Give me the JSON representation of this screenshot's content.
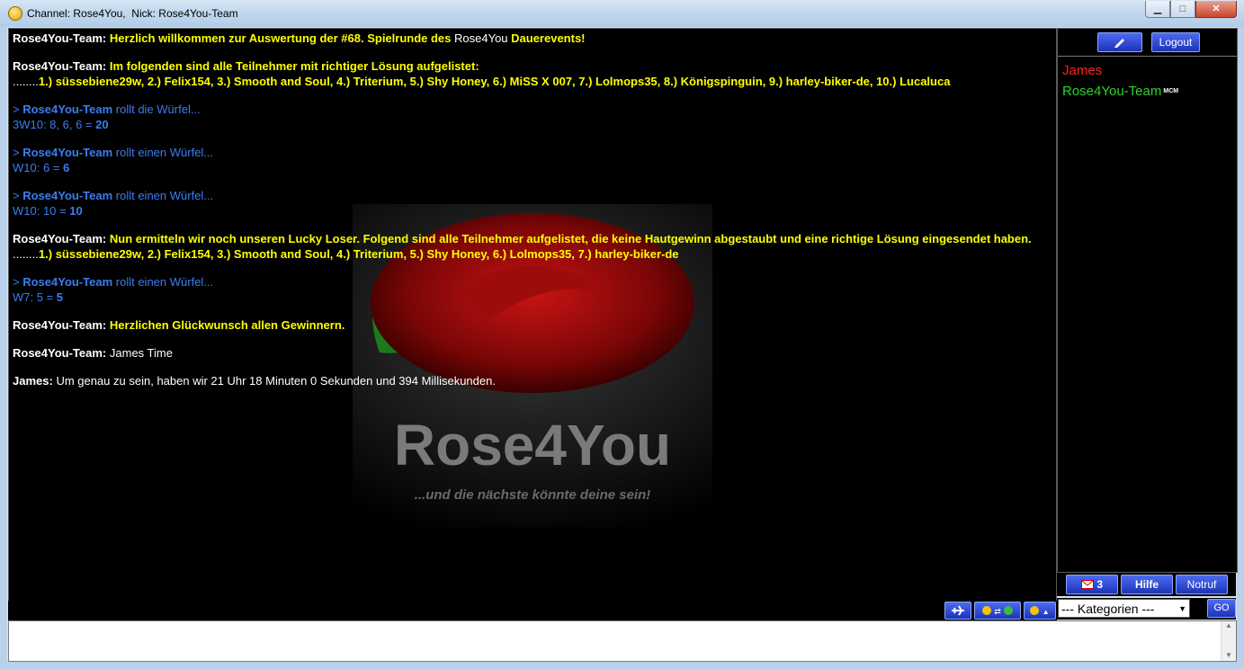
{
  "window": {
    "title": "Channel: Rose4You,  Nick: Rose4You-Team",
    "minimize": "▁",
    "maximize": "□",
    "close": "✕"
  },
  "watermark": {
    "brand": "Rose4You",
    "slogan": "...und die nächste könnte deine sein!"
  },
  "messages": [
    {
      "nick": "Rose4You-Team:",
      "parts": [
        "Herzlich willkommen zur Auswertung der #68. Spielrunde des ",
        "Rose4You",
        " Dauerevents!"
      ]
    },
    {
      "nick": "Rose4You-Team:",
      "text": "Im folgenden sind alle Teilnehmer mit richtiger Lösung aufgelistet:",
      "text2_prefix": "........",
      "text2": "1.) süssebiene29w, 2.) Felix154, 3.) Smooth and Soul, 4.) Triterium, 5.) Shy Honey, 6.) MiSS X 007, 7.) Lolmops35, 8.) Königspinguin, 9.) harley-biker-de, 10.) Lucaluca"
    },
    {
      "prefix": "> ",
      "nick": "Rose4You-Team",
      "action": " rollt die Würfel...",
      "result_label": "3W10: 8, 6, 6 = ",
      "result": "20"
    },
    {
      "prefix": "> ",
      "nick": "Rose4You-Team",
      "action": " rollt einen Würfel...",
      "result_label": "W10: 6 = ",
      "result": "6"
    },
    {
      "prefix": "> ",
      "nick": "Rose4You-Team",
      "action": " rollt einen Würfel...",
      "result_label": "W10: 10 = ",
      "result": "10"
    },
    {
      "nick": "Rose4You-Team:",
      "text": "Nun ermitteln wir noch unseren Lucky Loser. Folgend sind alle Teilnehmer aufgelistet, die keine Hautgewinn abgestaubt und eine richtige Lösung eingesendet haben.",
      "text2_prefix": "........",
      "text2": "1.) süssebiene29w, 2.) Felix154, 3.) Smooth and Soul, 4.) Triterium, 5.) Shy Honey, 6.) Lolmops35, 7.) harley-biker-de"
    },
    {
      "prefix": "> ",
      "nick": "Rose4You-Team",
      "action": " rollt einen Würfel...",
      "result_label": "W7: 5 = ",
      "result": "5"
    },
    {
      "nick": "Rose4You-Team:",
      "text": "Herzlichen Glückwunsch allen Gewinnern."
    },
    {
      "nick": "Rose4You-Team:",
      "text": "James Time"
    },
    {
      "nick": "James:",
      "text": "Um genau zu sein, haben wir 21 Uhr 18 Minuten 0 Sekunden und 394 Millisekunden."
    }
  ],
  "sidebar": {
    "logout": "Logout",
    "users": [
      {
        "name": "James",
        "color": "#ff2020"
      },
      {
        "name": "Rose4You-Team",
        "badge": "MCM",
        "color": "#2fd12f"
      }
    ],
    "mail_count": "3",
    "help": "Hilfe",
    "emergency": "Notruf",
    "category_select": "--- Kategorien ---",
    "go": "GO"
  },
  "colors": {
    "chat_bg": "#000000",
    "system_text": "#ffff00",
    "dice_text": "#3a7df0",
    "button_blue": "#2a45d0"
  }
}
